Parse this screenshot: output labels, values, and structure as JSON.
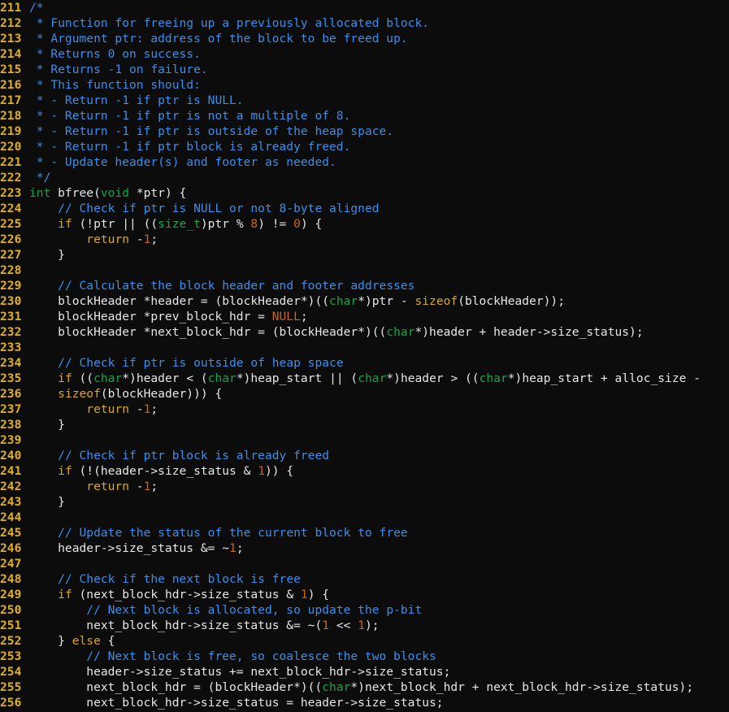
{
  "window": {
    "title": "",
    "colors": {
      "background": "#0c0c0c",
      "plain": "#e6e6e6",
      "line_number": "#e0b020",
      "comment": "#3b8eea",
      "keyword": "#d7a821",
      "type": "#16a34a",
      "number": "#c8651b",
      "constant": "#c8651b",
      "function": "#d7a821"
    }
  },
  "editor": {
    "lines": [
      {
        "num": "211",
        "tokens": [
          {
            "t": "/*",
            "c": "comment"
          }
        ]
      },
      {
        "num": "212",
        "tokens": [
          {
            "t": " * Function for freeing up a previously allocated block.",
            "c": "comment"
          }
        ]
      },
      {
        "num": "213",
        "tokens": [
          {
            "t": " * Argument ptr: address of the block to be freed up.",
            "c": "comment"
          }
        ]
      },
      {
        "num": "214",
        "tokens": [
          {
            "t": " * Returns 0 on success.",
            "c": "comment"
          }
        ]
      },
      {
        "num": "215",
        "tokens": [
          {
            "t": " * Returns -1 on failure.",
            "c": "comment"
          }
        ]
      },
      {
        "num": "216",
        "tokens": [
          {
            "t": " * This function should:",
            "c": "comment"
          }
        ]
      },
      {
        "num": "217",
        "tokens": [
          {
            "t": " * - Return -1 if ptr is NULL.",
            "c": "comment"
          }
        ]
      },
      {
        "num": "218",
        "tokens": [
          {
            "t": " * - Return -1 if ptr is not a multiple of 8.",
            "c": "comment"
          }
        ]
      },
      {
        "num": "219",
        "tokens": [
          {
            "t": " * - Return -1 if ptr is outside of the heap space.",
            "c": "comment"
          }
        ]
      },
      {
        "num": "220",
        "tokens": [
          {
            "t": " * - Return -1 if ptr block is already freed.",
            "c": "comment"
          }
        ]
      },
      {
        "num": "221",
        "tokens": [
          {
            "t": " * - Update header(s) and footer as needed.",
            "c": "comment"
          }
        ]
      },
      {
        "num": "222",
        "tokens": [
          {
            "t": " */",
            "c": "comment"
          }
        ]
      },
      {
        "num": "223",
        "tokens": [
          {
            "t": "int",
            "c": "type"
          },
          {
            "t": " bfree(",
            "c": "plain"
          },
          {
            "t": "void",
            "c": "type"
          },
          {
            "t": " *ptr) {",
            "c": "plain"
          }
        ]
      },
      {
        "num": "224",
        "tokens": [
          {
            "t": "    ",
            "c": "plain"
          },
          {
            "t": "// Check if ptr is NULL or not 8-byte aligned",
            "c": "comment"
          }
        ]
      },
      {
        "num": "225",
        "tokens": [
          {
            "t": "    ",
            "c": "plain"
          },
          {
            "t": "if",
            "c": "keyword"
          },
          {
            "t": " (!ptr || ((",
            "c": "plain"
          },
          {
            "t": "size_t",
            "c": "type"
          },
          {
            "t": ")ptr % ",
            "c": "plain"
          },
          {
            "t": "8",
            "c": "number"
          },
          {
            "t": ") != ",
            "c": "plain"
          },
          {
            "t": "0",
            "c": "number"
          },
          {
            "t": ") {",
            "c": "plain"
          }
        ]
      },
      {
        "num": "226",
        "tokens": [
          {
            "t": "        ",
            "c": "plain"
          },
          {
            "t": "return",
            "c": "keyword"
          },
          {
            "t": " -",
            "c": "plain"
          },
          {
            "t": "1",
            "c": "number"
          },
          {
            "t": ";",
            "c": "plain"
          }
        ]
      },
      {
        "num": "227",
        "tokens": [
          {
            "t": "    }",
            "c": "plain"
          }
        ]
      },
      {
        "num": "228",
        "tokens": []
      },
      {
        "num": "229",
        "tokens": [
          {
            "t": "    ",
            "c": "plain"
          },
          {
            "t": "// Calculate the block header and footer addresses",
            "c": "comment"
          }
        ]
      },
      {
        "num": "230",
        "tokens": [
          {
            "t": "    blockHeader *header = (blockHeader*)((",
            "c": "plain"
          },
          {
            "t": "char",
            "c": "type"
          },
          {
            "t": "*)ptr - ",
            "c": "plain"
          },
          {
            "t": "sizeof",
            "c": "function"
          },
          {
            "t": "(blockHeader));",
            "c": "plain"
          }
        ]
      },
      {
        "num": "231",
        "tokens": [
          {
            "t": "    blockHeader *prev_block_hdr = ",
            "c": "plain"
          },
          {
            "t": "NULL",
            "c": "constant"
          },
          {
            "t": ";",
            "c": "plain"
          }
        ]
      },
      {
        "num": "232",
        "tokens": [
          {
            "t": "    blockHeader *next_block_hdr = (blockHeader*)((",
            "c": "plain"
          },
          {
            "t": "char",
            "c": "type"
          },
          {
            "t": "*)header + header->size_status);",
            "c": "plain"
          }
        ]
      },
      {
        "num": "233",
        "tokens": []
      },
      {
        "num": "234",
        "tokens": [
          {
            "t": "    ",
            "c": "plain"
          },
          {
            "t": "// Check if ptr is outside of heap space",
            "c": "comment"
          }
        ]
      },
      {
        "num": "235",
        "tokens": [
          {
            "t": "    ",
            "c": "plain"
          },
          {
            "t": "if",
            "c": "keyword"
          },
          {
            "t": " ((",
            "c": "plain"
          },
          {
            "t": "char",
            "c": "type"
          },
          {
            "t": "*)header < (",
            "c": "plain"
          },
          {
            "t": "char",
            "c": "type"
          },
          {
            "t": "*)heap_start || (",
            "c": "plain"
          },
          {
            "t": "char",
            "c": "type"
          },
          {
            "t": "*)header > ((",
            "c": "plain"
          },
          {
            "t": "char",
            "c": "type"
          },
          {
            "t": "*)heap_start + alloc_size -",
            "c": "plain"
          }
        ]
      },
      {
        "num": "236",
        "tokens": [
          {
            "t": "    ",
            "c": "plain"
          },
          {
            "t": "sizeof",
            "c": "function"
          },
          {
            "t": "(blockHeader))) {",
            "c": "plain"
          }
        ]
      },
      {
        "num": "237",
        "tokens": [
          {
            "t": "        ",
            "c": "plain"
          },
          {
            "t": "return",
            "c": "keyword"
          },
          {
            "t": " -",
            "c": "plain"
          },
          {
            "t": "1",
            "c": "number"
          },
          {
            "t": ";",
            "c": "plain"
          }
        ]
      },
      {
        "num": "238",
        "tokens": [
          {
            "t": "    }",
            "c": "plain"
          }
        ]
      },
      {
        "num": "239",
        "tokens": []
      },
      {
        "num": "240",
        "tokens": [
          {
            "t": "    ",
            "c": "plain"
          },
          {
            "t": "// Check if ptr block is already freed",
            "c": "comment"
          }
        ]
      },
      {
        "num": "241",
        "tokens": [
          {
            "t": "    ",
            "c": "plain"
          },
          {
            "t": "if",
            "c": "keyword"
          },
          {
            "t": " (!(header->size_status & ",
            "c": "plain"
          },
          {
            "t": "1",
            "c": "number"
          },
          {
            "t": ")) {",
            "c": "plain"
          }
        ]
      },
      {
        "num": "242",
        "tokens": [
          {
            "t": "        ",
            "c": "plain"
          },
          {
            "t": "return",
            "c": "keyword"
          },
          {
            "t": " -",
            "c": "plain"
          },
          {
            "t": "1",
            "c": "number"
          },
          {
            "t": ";",
            "c": "plain"
          }
        ]
      },
      {
        "num": "243",
        "tokens": [
          {
            "t": "    }",
            "c": "plain"
          }
        ]
      },
      {
        "num": "244",
        "tokens": []
      },
      {
        "num": "245",
        "tokens": [
          {
            "t": "    ",
            "c": "plain"
          },
          {
            "t": "// Update the status of the current block to free",
            "c": "comment"
          }
        ]
      },
      {
        "num": "246",
        "tokens": [
          {
            "t": "    header->size_status &= ~",
            "c": "plain"
          },
          {
            "t": "1",
            "c": "number"
          },
          {
            "t": ";",
            "c": "plain"
          }
        ]
      },
      {
        "num": "247",
        "tokens": []
      },
      {
        "num": "248",
        "tokens": [
          {
            "t": "    ",
            "c": "plain"
          },
          {
            "t": "// Check if the next block is free",
            "c": "comment"
          }
        ]
      },
      {
        "num": "249",
        "tokens": [
          {
            "t": "    ",
            "c": "plain"
          },
          {
            "t": "if",
            "c": "keyword"
          },
          {
            "t": " (next_block_hdr->size_status & ",
            "c": "plain"
          },
          {
            "t": "1",
            "c": "number"
          },
          {
            "t": ") {",
            "c": "plain"
          }
        ]
      },
      {
        "num": "250",
        "tokens": [
          {
            "t": "        ",
            "c": "plain"
          },
          {
            "t": "// Next block is allocated, so update the p-bit",
            "c": "comment"
          }
        ]
      },
      {
        "num": "251",
        "tokens": [
          {
            "t": "        next_block_hdr->size_status &= ~(",
            "c": "plain"
          },
          {
            "t": "1",
            "c": "number"
          },
          {
            "t": " << ",
            "c": "plain"
          },
          {
            "t": "1",
            "c": "number"
          },
          {
            "t": ");",
            "c": "plain"
          }
        ]
      },
      {
        "num": "252",
        "tokens": [
          {
            "t": "    } ",
            "c": "plain"
          },
          {
            "t": "else",
            "c": "keyword"
          },
          {
            "t": " {",
            "c": "plain"
          }
        ]
      },
      {
        "num": "253",
        "tokens": [
          {
            "t": "        ",
            "c": "plain"
          },
          {
            "t": "// Next block is free, so coalesce the two blocks",
            "c": "comment"
          }
        ]
      },
      {
        "num": "254",
        "tokens": [
          {
            "t": "        header->size_status += next_block_hdr->size_status;",
            "c": "plain"
          }
        ]
      },
      {
        "num": "255",
        "tokens": [
          {
            "t": "        next_block_hdr = (blockHeader*)((",
            "c": "plain"
          },
          {
            "t": "char",
            "c": "type"
          },
          {
            "t": "*)next_block_hdr + next_block_hdr->size_status);",
            "c": "plain"
          }
        ]
      },
      {
        "num": "256",
        "tokens": [
          {
            "t": "        next_block_hdr->size_status = header->size_status;",
            "c": "plain"
          }
        ]
      }
    ]
  }
}
